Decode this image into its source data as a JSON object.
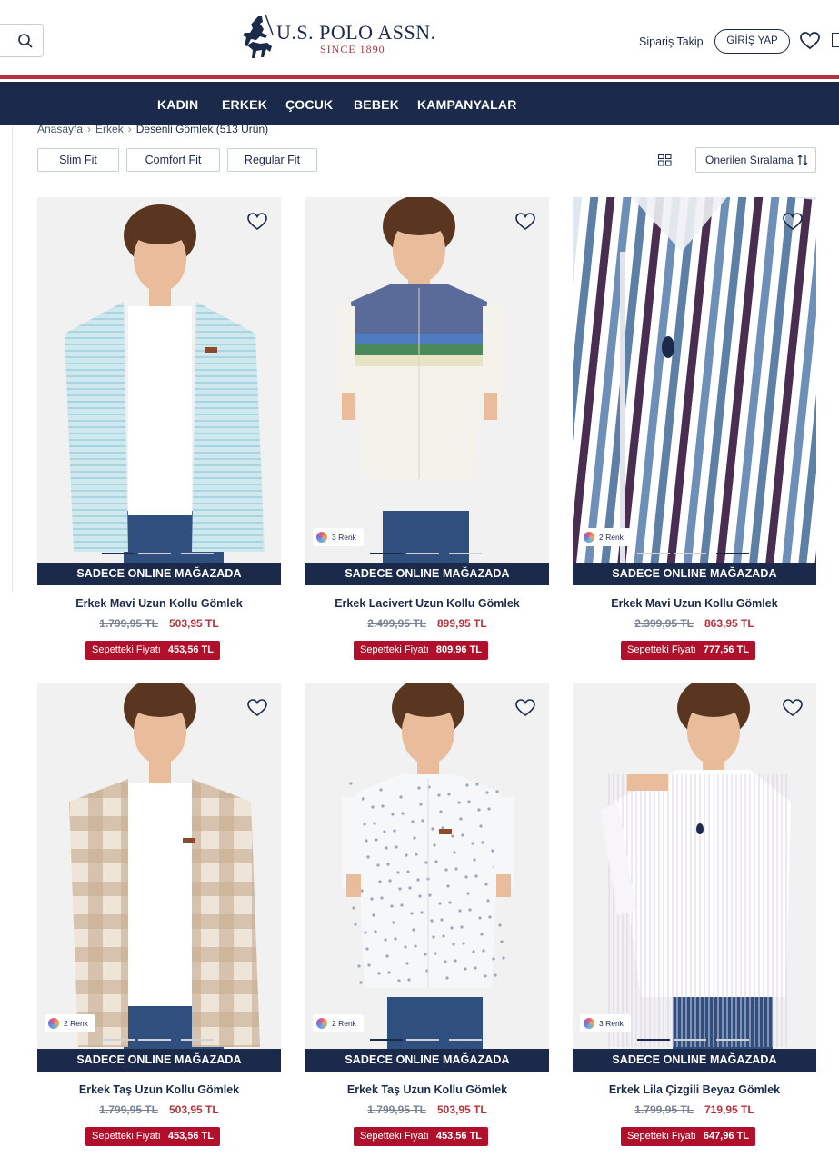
{
  "header": {
    "logo_text": "U.S. POLO ASSN.",
    "logo_sub": "SINCE 1890",
    "order_track": "Sipariş Takip",
    "login": "GİRİŞ YAP"
  },
  "nav": [
    "KADIN",
    "ERKEK",
    "ÇOCUK",
    "BEBEK",
    "KAMPANYALAR"
  ],
  "breadcrumb": {
    "home": "Anasayfa",
    "category": "Erkek",
    "current": "Desenli Gömlek",
    "count": "(513 Ürün)"
  },
  "filters": [
    "Slim Fit",
    "Comfort Fit",
    "Regular Fit"
  ],
  "sort": {
    "label": "Önerilen Sıralama"
  },
  "colors": {
    "navy": "#1b2a4a",
    "red": "#b5323e",
    "basket_red": "#b0102b"
  },
  "products": [
    {
      "title": "Erkek Mavi Uzun Kollu Gömlek",
      "old_price": "1.799,95 TL",
      "price": "503,95 TL",
      "basket_label": "Sepetteki Fiyatı",
      "basket_price": "453,56 TL",
      "banner": "SADECE ONLINE MAĞAZADA",
      "colors": "",
      "image": "light-blue-striped-shirt"
    },
    {
      "title": "Erkek Lacivert Uzun Kollu Gömlek",
      "old_price": "2.499,95 TL",
      "price": "899,95 TL",
      "basket_label": "Sepetteki Fiyatı",
      "basket_price": "809,96 TL",
      "banner": "SADECE ONLINE MAĞAZADA",
      "colors": "3 Renk",
      "image": "colorblock-shirt"
    },
    {
      "title": "Erkek Mavi Uzun Kollu Gömlek",
      "old_price": "2.399,95 TL",
      "price": "863,95 TL",
      "basket_label": "Sepetteki Fiyatı",
      "basket_price": "777,56 TL",
      "banner": "SADECE ONLINE MAĞAZADA",
      "colors": "2 Renk",
      "image": "blue-stripe-closeup"
    },
    {
      "title": "Erkek Taş Uzun Kollu Gömlek",
      "old_price": "1.799,95 TL",
      "price": "503,95 TL",
      "basket_label": "Sepetteki Fiyatı",
      "basket_price": "453,56 TL",
      "banner": "SADECE ONLINE MAĞAZADA",
      "colors": "2 Renk",
      "image": "beige-check-shirt"
    },
    {
      "title": "Erkek Taş Uzun Kollu Gömlek",
      "old_price": "1.799,95 TL",
      "price": "503,95 TL",
      "basket_label": "Sepetteki Fiyatı",
      "basket_price": "453,56 TL",
      "banner": "SADECE ONLINE MAĞAZADA",
      "colors": "2 Renk",
      "image": "white-print-shirt"
    },
    {
      "title": "Erkek Lila Çizgili Beyaz Gömlek",
      "old_price": "1.799,95 TL",
      "price": "719,95 TL",
      "basket_label": "Sepetteki Fiyatı",
      "basket_price": "647,96 TL",
      "banner": "SADECE ONLINE MAĞAZADA",
      "colors": "3 Renk",
      "image": "white-pinstripe-shirt"
    }
  ]
}
